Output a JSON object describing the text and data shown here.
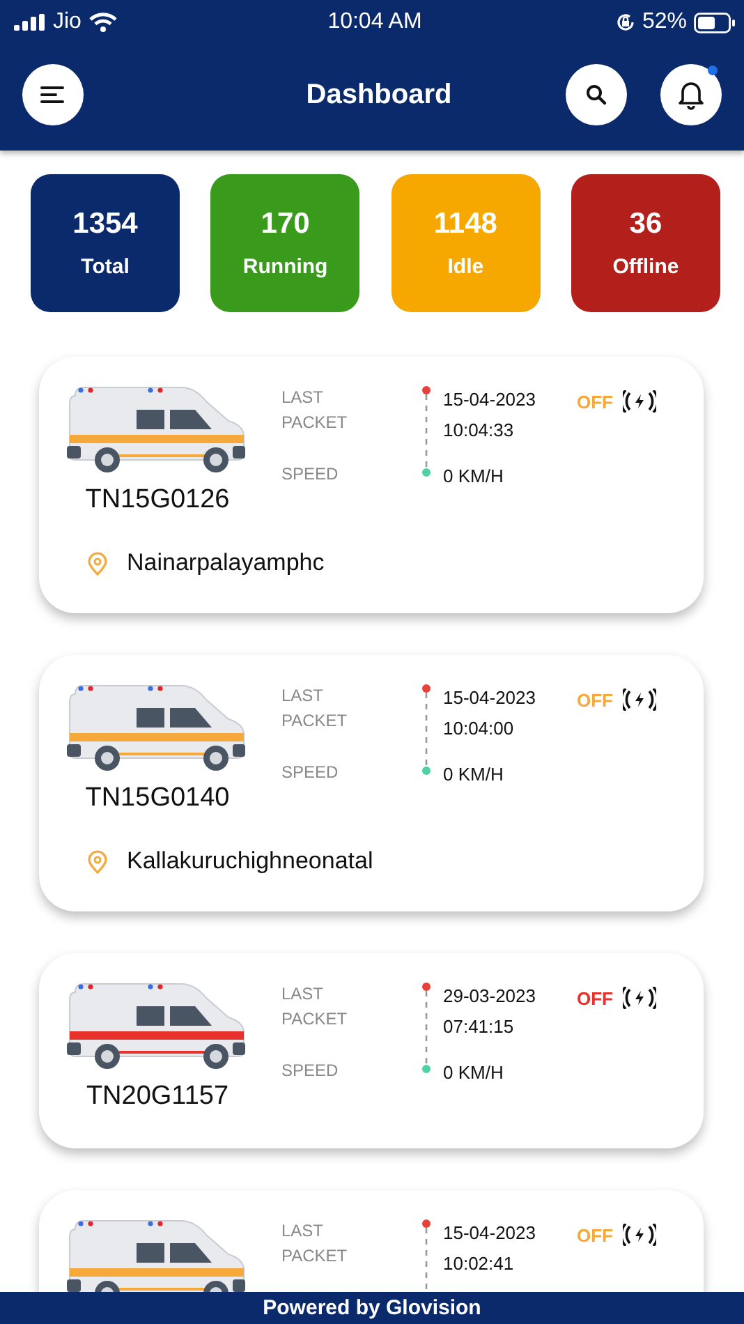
{
  "status_bar": {
    "carrier": "Jio",
    "time": "10:04 AM",
    "battery": "52%"
  },
  "header": {
    "title": "Dashboard",
    "notification_dot": true
  },
  "stats": [
    {
      "count": "1354",
      "label": "Total",
      "color": "#0b2a6b"
    },
    {
      "count": "170",
      "label": "Running",
      "color": "#3a9a1c"
    },
    {
      "count": "1148",
      "label": "Idle",
      "color": "#f6a800"
    },
    {
      "count": "36",
      "label": "Offline",
      "color": "#b3201c"
    }
  ],
  "vehicles": [
    {
      "plate": "TN15G0126",
      "last_packet_label": "LAST PACKET",
      "speed_label": "SPEED",
      "date": "15-04-2023",
      "time": "10:04:33",
      "speed": "0 KM/H",
      "status": "OFF",
      "color": "#f5a93a",
      "location": "Nainarpalayamphc"
    },
    {
      "plate": "TN15G0140",
      "last_packet_label": "LAST PACKET",
      "speed_label": "SPEED",
      "date": "15-04-2023",
      "time": "10:04:00",
      "speed": "0 KM/H",
      "status": "OFF",
      "color": "#f5a93a",
      "location": "Kallakuruchighneonatal"
    },
    {
      "plate": "TN20G1157",
      "last_packet_label": "LAST PACKET",
      "speed_label": "SPEED",
      "date": "29-03-2023",
      "time": "07:41:15",
      "speed": "0 KM/H",
      "status": "OFF",
      "color": "#e8312c"
    },
    {
      "last_packet_label": "LAST PACKET",
      "date": "15-04-2023",
      "time": "10:02:41",
      "status": "OFF",
      "color": "#f5a93a"
    }
  ],
  "footer": "Powered by Glovision"
}
